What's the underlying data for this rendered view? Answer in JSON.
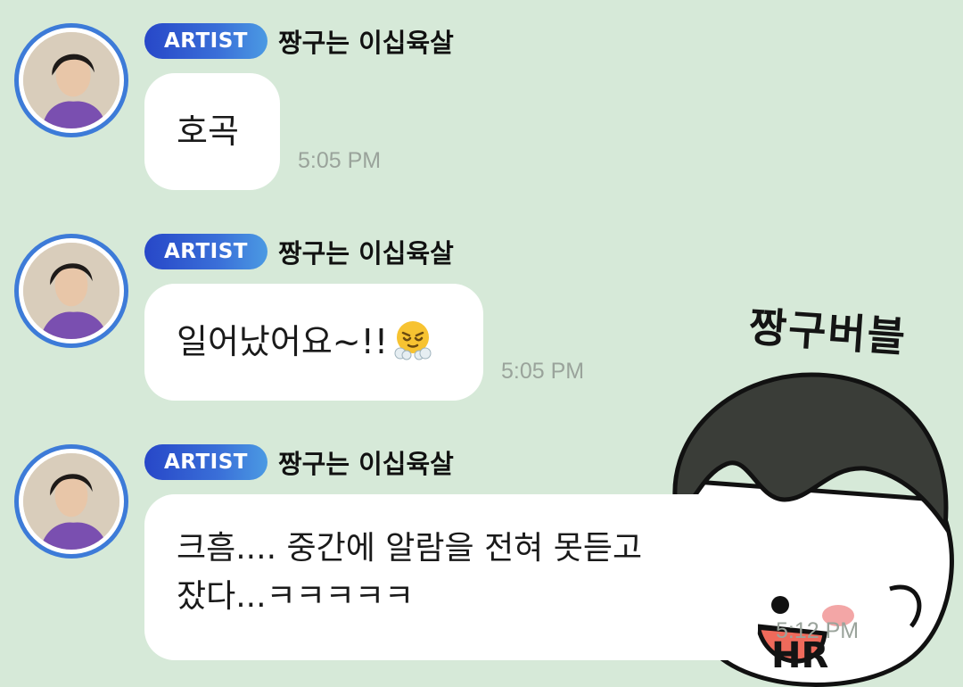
{
  "messages": [
    {
      "badge": "ARTIST",
      "author": "짱구는 이십육살",
      "text": "호곡",
      "time": "5:05 PM"
    },
    {
      "badge": "ARTIST",
      "author": "짱구는 이십육살",
      "text": "일어났어요~!!",
      "emoji": "face-with-steam-from-nose",
      "time": "5:05 PM"
    },
    {
      "badge": "ARTIST",
      "author": "짱구는 이십육살",
      "text_line1": "크흠.... 중간에 알람을 전혀 못듣고",
      "text_line2": "잤다...ㅋㅋㅋㅋㅋ",
      "time": "5:12 PM"
    }
  ],
  "sticker": {
    "title": "짱구버블",
    "signature": "HR"
  },
  "colors": {
    "background": "#d6e9d8",
    "bubble": "#ffffff",
    "badge_start": "#2747c8",
    "badge_end": "#4b9ae3",
    "avatar_ring": "#3d7bd8",
    "timestamp": "#9aa39b"
  }
}
